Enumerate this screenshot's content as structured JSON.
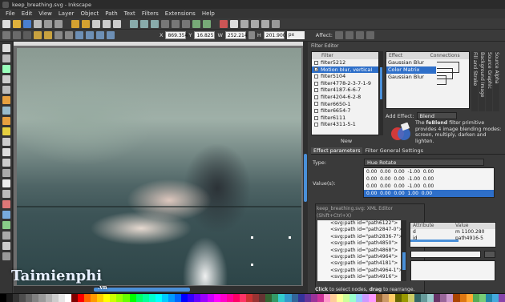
{
  "window": {
    "title": "keep_breathing.svg - Inkscape"
  },
  "menubar": {
    "items": [
      "File",
      "Edit",
      "View",
      "Layer",
      "Object",
      "Path",
      "Text",
      "Filters",
      "Extensions",
      "Help"
    ]
  },
  "controls": {
    "x_label": "X",
    "x_value": "869.354",
    "y_label": "Y",
    "y_value": "16.825",
    "w_label": "W",
    "w_value": "252.214",
    "h_label": "H",
    "h_value": "201.900",
    "unit": "px",
    "affect_label": "Affect:"
  },
  "filter_editor": {
    "title": "Filter Editor",
    "filter_column_header": "Filter",
    "filters": [
      {
        "name": "filter5212",
        "checked": false,
        "selected": false
      },
      {
        "name": "Motion blur, vertical",
        "checked": true,
        "selected": true
      },
      {
        "name": "filter5104",
        "checked": false,
        "selected": false
      },
      {
        "name": "filter4778-2-3-7-1-9",
        "checked": false,
        "selected": false
      },
      {
        "name": "filter4187-6-6-7",
        "checked": false,
        "selected": false
      },
      {
        "name": "filter4204-6-2-8",
        "checked": false,
        "selected": false
      },
      {
        "name": "filter6650-1",
        "checked": false,
        "selected": false
      },
      {
        "name": "filter6654-7",
        "checked": false,
        "selected": false
      },
      {
        "name": "filter6111",
        "checked": false,
        "selected": false
      },
      {
        "name": "filter4311-5-1",
        "checked": false,
        "selected": false
      }
    ],
    "new_button": "New",
    "effect_header": "Effect",
    "connections_header": "Connections",
    "effects": [
      {
        "name": "Gaussian Blur",
        "selected": false
      },
      {
        "name": "Color Matrix",
        "selected": true
      },
      {
        "name": "Gaussian Blur",
        "selected": false
      }
    ],
    "side_tabs": [
      "Fill and Stroke",
      "Background Image",
      "Source Graphic",
      "Source Alpha"
    ],
    "add_effect_label": "Add Effect:",
    "add_effect_value": "Blend",
    "primitive_description_lead": "The ",
    "primitive_description_name": "feBlend",
    "primitive_description_rest": " filter primitive provides 4 image blending modes: screen, multiply, darken and lighten.",
    "tabs": [
      "Effect parameters",
      "Filter General Settings"
    ],
    "type_label": "Type:",
    "type_value": "Hue Rotate",
    "values_label": "Value(s):",
    "matrix_rows": [
      {
        "text": "0.00  0.00  0.00  -1.00  0.00",
        "selected": false
      },
      {
        "text": "0.00  0.00  0.00  -1.00  0.00",
        "selected": false
      },
      {
        "text": "0.00  0.00  0.00  -1.00  0.00",
        "selected": false
      },
      {
        "text": "0.00  0.00  0.00  1.00  0.00",
        "selected": true
      }
    ]
  },
  "xml_editor": {
    "title": "keep_breathing.svg: XML Editor (Shift+Ctrl+X)",
    "nodes": [
      "<svg:path id=\"path6122\">",
      "<svg:path id=\"path2847-0\">",
      "<svg:path id=\"path2836-7\">",
      "<svg:path id=\"path4850\">",
      "<svg:path id=\"path4868\">",
      "<svg:path id=\"path4964\">",
      "<svg:path id=\"path4181\">",
      "<svg:path id=\"path4964-1\">",
      "<svg:path id=\"path4916\">"
    ],
    "attribute_header": "Attribute",
    "value_header": "Value",
    "attributes": [
      {
        "name": "d",
        "value": "m 1100.280"
      },
      {
        "name": "id",
        "value": "path4916-5"
      }
    ],
    "hint_lead": "Click",
    "hint_mid": " to select nodes, ",
    "hint_bold": "drag",
    "hint_end": " to rearrange."
  },
  "watermark": {
    "text": "Taimienphi",
    "suffix": ".vn"
  },
  "colors": {
    "selection_blue": "#2e6fc9",
    "scroll_blue": "#4a90d9"
  },
  "palette": [
    "#000000",
    "#1a1a1a",
    "#333333",
    "#4d4d4d",
    "#666666",
    "#808080",
    "#999999",
    "#b3b3b3",
    "#cccccc",
    "#e6e6e6",
    "#ffffff",
    "#800000",
    "#ff0000",
    "#ff6600",
    "#ff9900",
    "#ffcc00",
    "#ffff00",
    "#ccff00",
    "#99ff00",
    "#66ff00",
    "#00ff00",
    "#00ff66",
    "#00ff99",
    "#00ffcc",
    "#00ffff",
    "#00ccff",
    "#0099ff",
    "#0066ff",
    "#0000ff",
    "#3300ff",
    "#6600ff",
    "#9900ff",
    "#cc00ff",
    "#ff00ff",
    "#ff00cc",
    "#ff0099",
    "#ff0066",
    "#ff3366",
    "#cc3333",
    "#993333",
    "#663333",
    "#336633",
    "#339966",
    "#33cccc",
    "#3399cc",
    "#336699",
    "#333399",
    "#663399",
    "#993399",
    "#cc3399",
    "#ff99cc",
    "#ffcc99",
    "#ffff99",
    "#ccff99",
    "#99ffcc",
    "#99ccff",
    "#cc99ff",
    "#ff99ff",
    "#996633",
    "#cc9966",
    "#ffcc66",
    "#666600",
    "#999900",
    "#cccc66",
    "#336666",
    "#669999",
    "#99cccc",
    "#663366",
    "#996699",
    "#cc99cc",
    "#aa4400",
    "#dd7711",
    "#ffaa33",
    "#55aa55",
    "#77cc77",
    "#2288aa",
    "#44aadd",
    "#8844aa"
  ],
  "toolbar_icons": [
    "new-icon",
    "open-icon",
    "save-icon",
    "print-icon",
    "import-icon",
    "export-icon",
    "undo-icon",
    "redo-icon",
    "copy-icon",
    "cut-icon",
    "paste-icon",
    "zoom-selection-icon",
    "zoom-drawing-icon",
    "zoom-page-icon",
    "duplicate-icon",
    "clone-icon",
    "unlink-icon",
    "group-icon",
    "ungroup-icon",
    "fill-stroke-icon",
    "text-font-icon",
    "layers-icon",
    "xml-editor-icon",
    "align-icon",
    "preferences-icon"
  ],
  "tools": [
    "selector-tool-icon",
    "node-tool-icon",
    "tweak-tool-icon",
    "zoom-tool-icon",
    "measure-tool-icon",
    "rect-tool-icon",
    "3dbox-tool-icon",
    "ellipse-tool-icon",
    "star-tool-icon",
    "spiral-tool-icon",
    "pencil-tool-icon",
    "pen-tool-icon",
    "calligraphy-tool-icon",
    "text-tool-icon",
    "spray-tool-icon",
    "eraser-tool-icon",
    "bucket-tool-icon",
    "gradient-tool-icon",
    "mesh-tool-icon",
    "dropper-tool-icon",
    "connector-tool-icon"
  ]
}
